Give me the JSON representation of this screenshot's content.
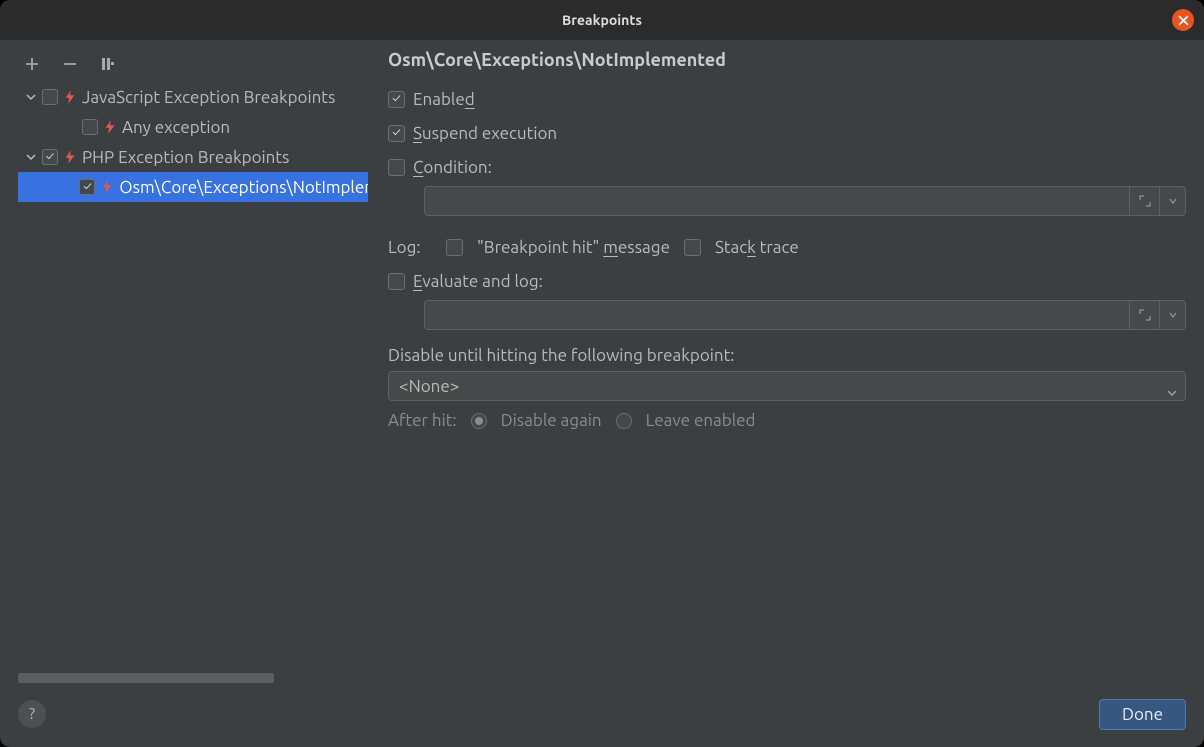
{
  "title": "Breakpoints",
  "toolbar": {
    "add": "+",
    "remove": "−"
  },
  "tree": {
    "groups": [
      {
        "label": "JavaScript Exception Breakpoints",
        "checked": false,
        "children": [
          {
            "label": "Any exception",
            "checked": false
          }
        ]
      },
      {
        "label": "PHP Exception Breakpoints",
        "checked": true,
        "children": [
          {
            "label": "Osm\\Core\\Exceptions\\NotImplemented",
            "checked": true,
            "selected": true
          }
        ]
      }
    ]
  },
  "details": {
    "heading": "Osm\\Core\\Exceptions\\NotImplemented",
    "enabled": {
      "pre": "Enable",
      "u": "d",
      "checked": true
    },
    "suspend": {
      "u": "S",
      "post": "uspend execution",
      "checked": true
    },
    "condition": {
      "u": "C",
      "post": "ondition:",
      "checked": false,
      "value": ""
    },
    "log_label": "Log:",
    "log_hit": {
      "pre": "\"Breakpoint hit\" ",
      "u": "m",
      "post": "essage",
      "checked": false
    },
    "log_stack": {
      "pre": "Stac",
      "u": "k",
      "post": " trace",
      "checked": false
    },
    "evaluate": {
      "u": "E",
      "post": "valuate and log:",
      "checked": false,
      "value": ""
    },
    "disable_until_label": "Disable until hitting the following breakpoint:",
    "disable_until_value": "<None>",
    "after_hit_label": "After hit:",
    "after_hit_options": {
      "disable_again": "Disable again",
      "leave_enabled": "Leave enabled"
    }
  },
  "footer": {
    "help": "?",
    "done": "Done"
  },
  "colors": {
    "accent": "#3772e0",
    "close": "#e95420",
    "lightning": "#e05555"
  }
}
